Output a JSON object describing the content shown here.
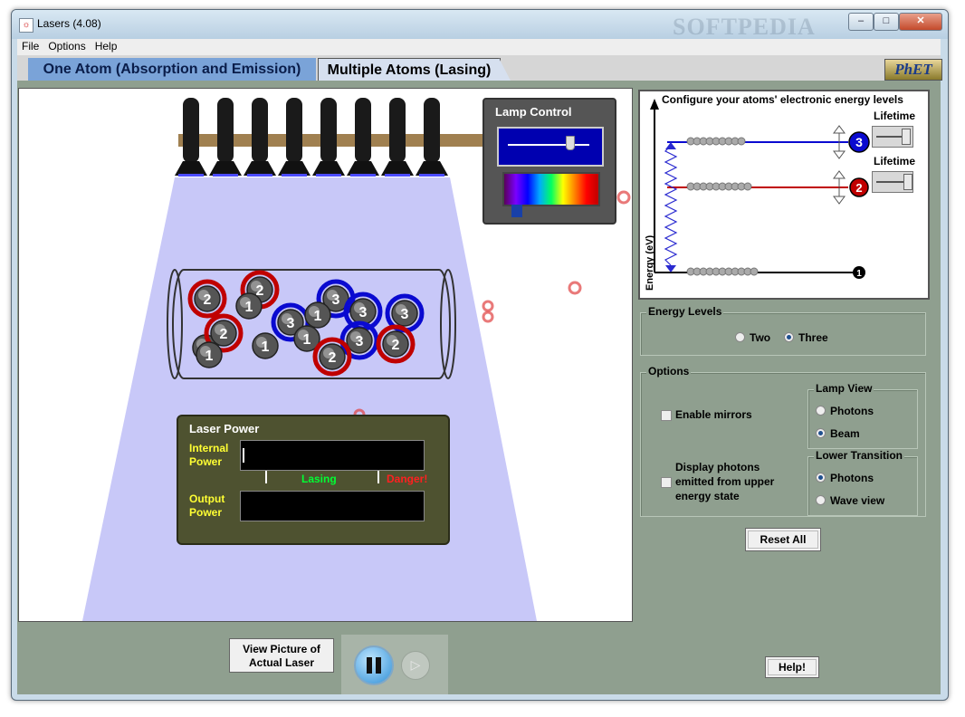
{
  "window": {
    "title": "Lasers (4.08)",
    "watermark": "SOFTPEDIA",
    "buttons": {
      "minimize": "–",
      "maximize": "□",
      "close": "✕"
    }
  },
  "menu": [
    "File",
    "Options",
    "Help"
  ],
  "tabs": [
    {
      "label": "One Atom (Absorption and Emission)",
      "selected": false
    },
    {
      "label": "Multiple Atoms (Lasing)",
      "selected": true
    }
  ],
  "logo": "PhET",
  "lamp_control": {
    "title": "Lamp Control",
    "intensity_fraction": 0.75,
    "wavelength_marker_fraction": 0.1
  },
  "laser_power": {
    "title": "Laser Power",
    "internal_label_1": "Internal",
    "internal_label_2": "Power",
    "output_label_1": "Output",
    "output_label_2": "Power",
    "lasing_label": "Lasing",
    "danger_label": "Danger!"
  },
  "energy_panel": {
    "header": "Configure your atoms' electronic energy levels",
    "y_axis_label": "Energy (eV)",
    "levels": [
      {
        "number": "3",
        "lifetime_label": "Lifetime",
        "color": "#0a0ad0"
      },
      {
        "number": "2",
        "lifetime_label": "Lifetime",
        "color": "#c00000"
      },
      {
        "number": "1",
        "color": "#000000"
      }
    ]
  },
  "energy_levels_group": {
    "title": "Energy Levels",
    "options": [
      {
        "label": "Two",
        "selected": false
      },
      {
        "label": "Three",
        "selected": true
      }
    ]
  },
  "options_group": {
    "title": "Options",
    "enable_mirrors": {
      "label": "Enable mirrors",
      "checked": false
    },
    "display_photons": {
      "lines": [
        "Display photons",
        "emitted from upper",
        "energy state"
      ],
      "checked": false
    },
    "lamp_view": {
      "title": "Lamp View",
      "options": [
        {
          "label": "Photons",
          "selected": false
        },
        {
          "label": "Beam",
          "selected": true
        }
      ]
    },
    "lower_transition": {
      "title": "Lower Transition",
      "options": [
        {
          "label": "Photons",
          "selected": true
        },
        {
          "label": "Wave view",
          "selected": false
        }
      ]
    }
  },
  "buttons": {
    "reset_all": "Reset All",
    "help": "Help!",
    "view_picture_1": "View Picture of",
    "view_picture_2": "Actual Laser"
  },
  "atoms": [
    {
      "n": "2",
      "ring": "red"
    },
    {
      "n": "2",
      "ring": "red"
    },
    {
      "n": "1",
      "ring": "none"
    },
    {
      "n": "1",
      "ring": "none"
    },
    {
      "n": "3",
      "ring": "blue"
    },
    {
      "n": "3",
      "ring": "blue"
    },
    {
      "n": "3",
      "ring": "blue"
    },
    {
      "n": "2",
      "ring": "red"
    },
    {
      "n": "3",
      "ring": "blue"
    },
    {
      "n": "1",
      "ring": "none"
    },
    {
      "n": "1",
      "ring": "none"
    },
    {
      "n": "1",
      "ring": "none"
    },
    {
      "n": "3",
      "ring": "blue"
    },
    {
      "n": "2",
      "ring": "red"
    },
    {
      "n": "2",
      "ring": "red"
    },
    {
      "n": "1",
      "ring": "none"
    }
  ],
  "colors": {
    "beam": "#c8c8f8",
    "panel_bg": "#8f9f8f",
    "lamp_bar": "#a08050"
  }
}
